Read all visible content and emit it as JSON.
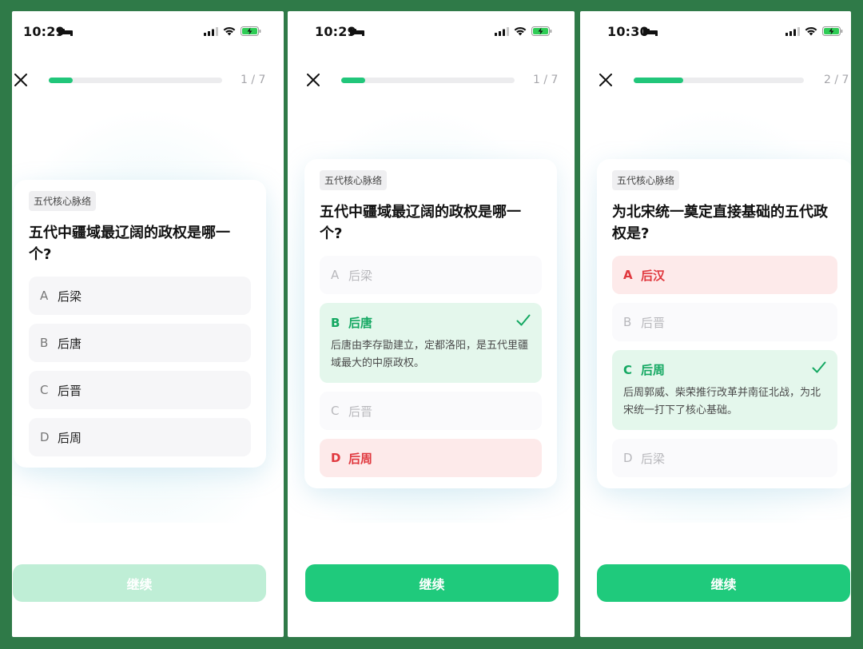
{
  "colors": {
    "accent": "#1fca7c",
    "correct_bg": "#e4f7ec",
    "wrong_bg": "#fdeaea",
    "wrong_text": "#e0383e"
  },
  "screens": [
    {
      "status_time": "10:29",
      "step_counter": "1 / 7",
      "progress_fraction": 0.14,
      "tag": "五代核心脉络",
      "question": "五代中疆域最辽阔的政权是哪一个?",
      "options": [
        {
          "letter": "A",
          "label": "后梁",
          "state": "default"
        },
        {
          "letter": "B",
          "label": "后唐",
          "state": "default"
        },
        {
          "letter": "C",
          "label": "后晋",
          "state": "default"
        },
        {
          "letter": "D",
          "label": "后周",
          "state": "default"
        }
      ],
      "continue_label": "继续",
      "continue_enabled": false
    },
    {
      "status_time": "10:29",
      "step_counter": "1 / 7",
      "progress_fraction": 0.14,
      "tag": "五代核心脉络",
      "question": "五代中疆域最辽阔的政权是哪一个?",
      "options": [
        {
          "letter": "A",
          "label": "后梁",
          "state": "faded"
        },
        {
          "letter": "B",
          "label": "后唐",
          "state": "correct",
          "explanation": "后唐由李存勖建立，定都洛阳，是五代里疆域最大的中原政权。"
        },
        {
          "letter": "C",
          "label": "后晋",
          "state": "faded"
        },
        {
          "letter": "D",
          "label": "后周",
          "state": "wrong"
        }
      ],
      "continue_label": "继续",
      "continue_enabled": true
    },
    {
      "status_time": "10:30",
      "step_counter": "2 / 7",
      "progress_fraction": 0.29,
      "tag": "五代核心脉络",
      "question": "为北宋统一奠定直接基础的五代政权是?",
      "options": [
        {
          "letter": "A",
          "label": "后汉",
          "state": "wrong"
        },
        {
          "letter": "B",
          "label": "后晋",
          "state": "faded"
        },
        {
          "letter": "C",
          "label": "后周",
          "state": "correct",
          "explanation": "后周郭威、柴荣推行改革并南征北战，为北宋统一打下了核心基础。"
        },
        {
          "letter": "D",
          "label": "后梁",
          "state": "faded"
        }
      ],
      "continue_label": "继续",
      "continue_enabled": true
    }
  ]
}
